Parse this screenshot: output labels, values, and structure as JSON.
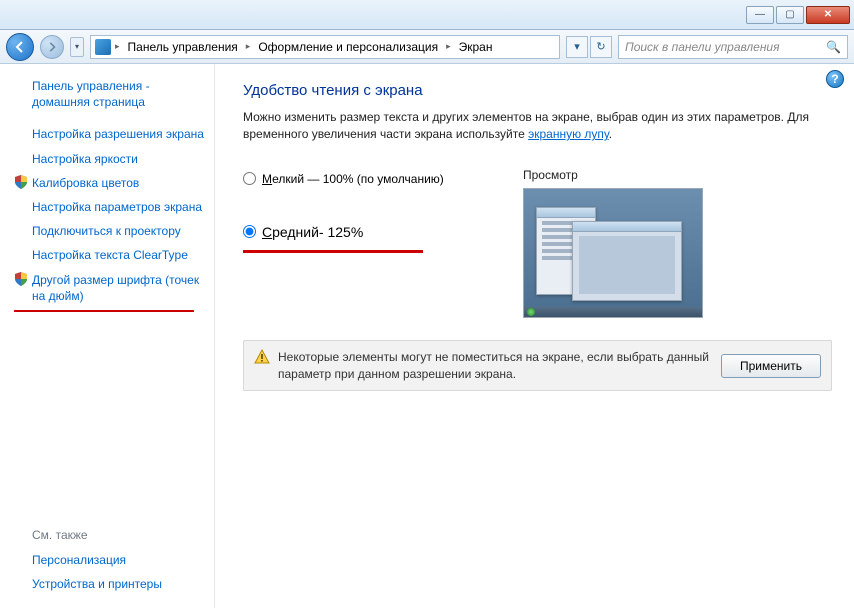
{
  "titlebar": {
    "min": "—",
    "max": "▢",
    "close": "✕"
  },
  "breadcrumb": {
    "items": [
      "Панель управления",
      "Оформление и персонализация",
      "Экран"
    ]
  },
  "toolbar": {
    "search_placeholder": "Поиск в панели управления"
  },
  "sidebar": {
    "home": "Панель управления - домашняя страница",
    "items": [
      {
        "label": "Настройка разрешения экрана",
        "shield": false
      },
      {
        "label": "Настройка яркости",
        "shield": false
      },
      {
        "label": "Калибровка цветов",
        "shield": true
      },
      {
        "label": "Настройка параметров экрана",
        "shield": false
      },
      {
        "label": "Подключиться к проектору",
        "shield": false
      },
      {
        "label": "Настройка текста ClearType",
        "shield": false
      },
      {
        "label": "Другой размер шрифта (точек на дюйм)",
        "shield": true,
        "underline": true
      }
    ],
    "footer_heading": "См. также",
    "footer_items": [
      "Персонализация",
      "Устройства и принтеры"
    ]
  },
  "content": {
    "title": "Удобство чтения с экрана",
    "desc_prefix": "Можно изменить размер текста и других элементов на экране, выбрав один из этих параметров. Для временного увеличения части экрана используйте ",
    "desc_link": "экранную лупу",
    "desc_suffix": ".",
    "radio_small": "елкий — 100% (по умолчанию)",
    "radio_small_u": "М",
    "radio_medium": "редний- 125%",
    "radio_medium_u": "С",
    "preview_heading": "Просмотр",
    "notice": "Некоторые элементы могут не поместиться на экране, если выбрать данный параметр при данном разрешении экрана.",
    "apply": "Применить"
  }
}
